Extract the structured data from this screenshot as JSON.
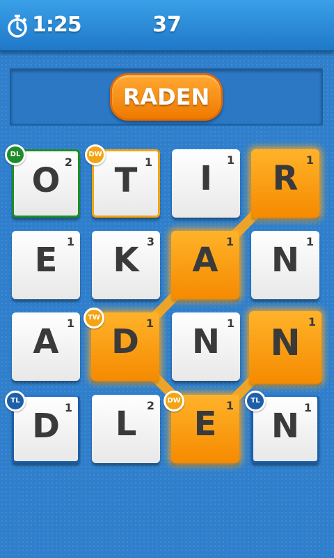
{
  "header": {
    "timer": "1:25",
    "score": "37"
  },
  "current_word": "RADEN",
  "colors": {
    "selected_tile": "#f58a00",
    "double_letter": "#1e8c2a",
    "double_word": "#f3a412",
    "triple_letter": "#1d5fa8",
    "background": "#2f7fcc"
  },
  "board": {
    "rows": [
      [
        {
          "letter": "O",
          "points": "2",
          "bonus": "DL"
        },
        {
          "letter": "T",
          "points": "1",
          "bonus": "DW"
        },
        {
          "letter": "I",
          "points": "1",
          "bonus": ""
        },
        {
          "letter": "R",
          "points": "1",
          "bonus": "",
          "selected": true
        }
      ],
      [
        {
          "letter": "E",
          "points": "1",
          "bonus": ""
        },
        {
          "letter": "K",
          "points": "3",
          "bonus": ""
        },
        {
          "letter": "A",
          "points": "1",
          "bonus": "",
          "selected": true
        },
        {
          "letter": "N",
          "points": "1",
          "bonus": ""
        }
      ],
      [
        {
          "letter": "A",
          "points": "1",
          "bonus": ""
        },
        {
          "letter": "D",
          "points": "1",
          "bonus": "TW",
          "selected": true
        },
        {
          "letter": "N",
          "points": "1",
          "bonus": ""
        },
        {
          "letter": "N",
          "points": "1",
          "bonus": "",
          "selected": true
        }
      ],
      [
        {
          "letter": "D",
          "points": "1",
          "bonus": "TL"
        },
        {
          "letter": "L",
          "points": "2",
          "bonus": ""
        },
        {
          "letter": "E",
          "points": "1",
          "bonus": "DW",
          "selected": true
        },
        {
          "letter": "N",
          "points": "1",
          "bonus": "TL"
        }
      ]
    ]
  }
}
